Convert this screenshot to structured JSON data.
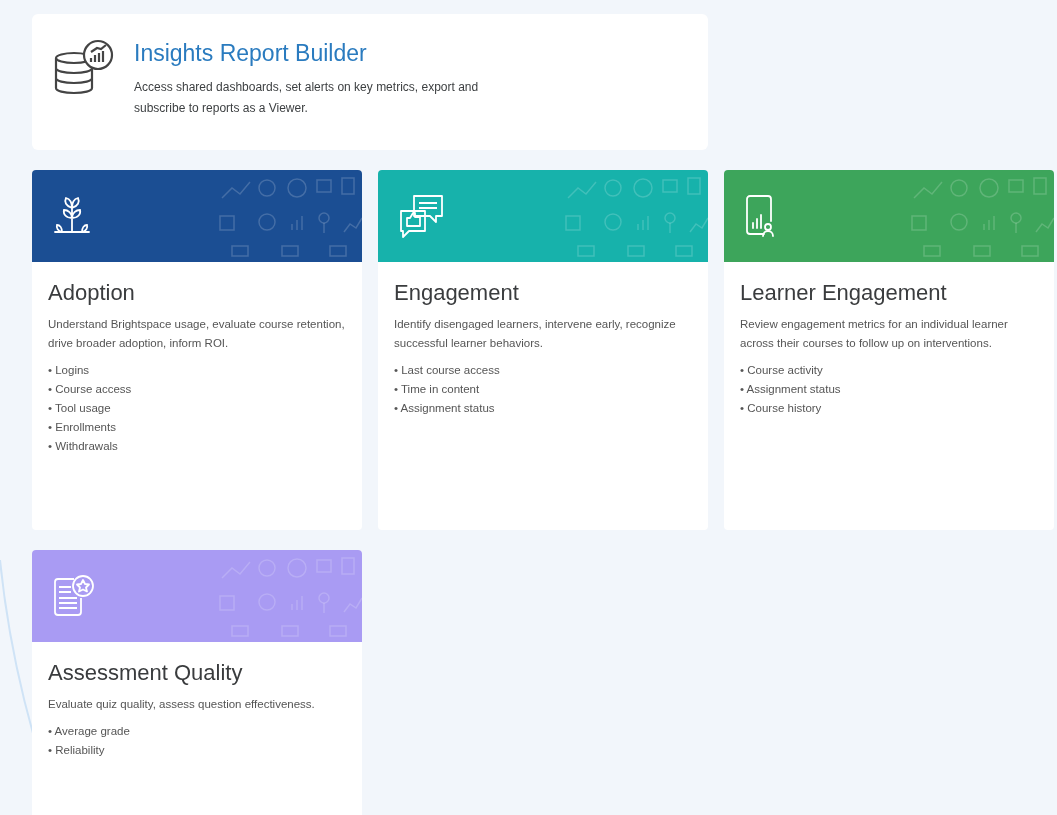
{
  "header": {
    "title": "Insights Report Builder",
    "description": "Access shared dashboards, set alerts on key metrics, export and subscribe to reports as a Viewer."
  },
  "cards": [
    {
      "kind": "plant",
      "color": "#1b4e93",
      "title": "Adoption",
      "description": "Understand Brightspace usage, evaluate course retention, drive broader adoption, inform ROI.",
      "items": [
        "• Logins",
        "• Course access",
        "• Tool usage",
        "• Enrollments",
        "• Withdrawals"
      ]
    },
    {
      "kind": "chat",
      "color": "#17b2ab",
      "title": "Engagement",
      "description": "Identify disengaged learners, intervene early, recognize successful learner behaviors.",
      "items": [
        "• Last course access",
        "• Time in content",
        "• Assignment status"
      ]
    },
    {
      "kind": "tablet",
      "color": "#3da55b",
      "title": "Learner Engagement",
      "description": "Review engagement metrics for an individual learner across their courses to follow up on interventions.",
      "items": [
        "• Course activity",
        "• Assignment status",
        "• Course history"
      ]
    },
    {
      "kind": "document",
      "color": "#a99bf3",
      "title": "Assessment Quality",
      "description": "Evaluate quiz quality, assess question effectiveness.",
      "items": [
        "• Average grade",
        "• Reliability"
      ]
    }
  ]
}
